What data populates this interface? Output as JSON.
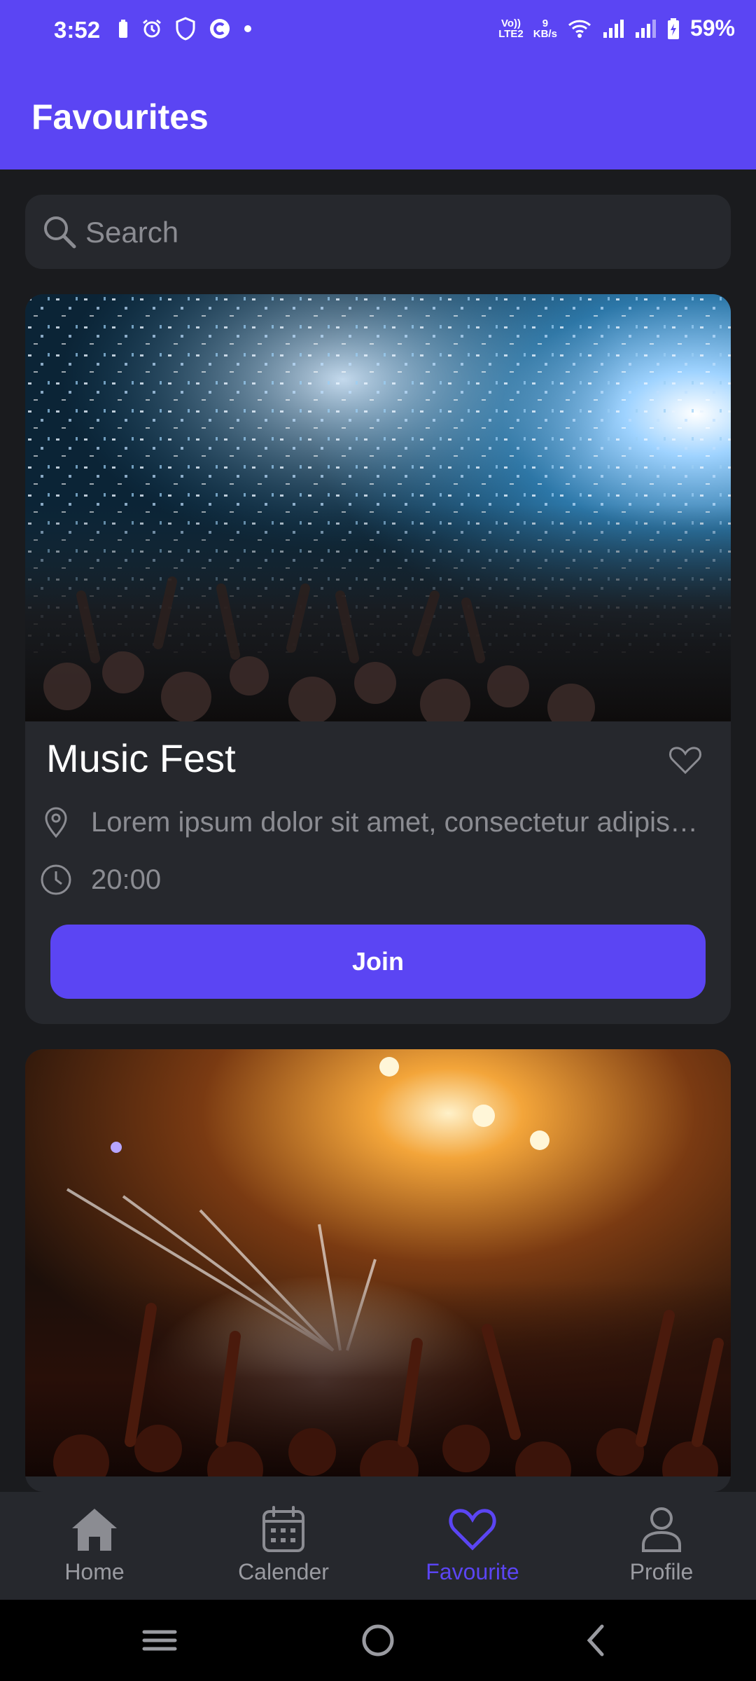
{
  "status_bar": {
    "time": "3:52",
    "net_top": "Vo))",
    "net_bottom": "LTE2",
    "speed_top": "9",
    "speed_bottom": "KB/s",
    "battery": "59%"
  },
  "app_bar": {
    "title": "Favourites"
  },
  "search": {
    "placeholder": "Search"
  },
  "events": [
    {
      "title": "Music Fest",
      "location": "Lorem ipsum dolor sit amet, consectetur adipiscing elit",
      "time": "20:00",
      "join_label": "Join",
      "favourited": false
    }
  ],
  "bottom_nav": {
    "items": [
      {
        "label": "Home",
        "icon": "home-icon"
      },
      {
        "label": "Calender",
        "icon": "calendar-icon"
      },
      {
        "label": "Favourite",
        "icon": "heart-icon",
        "active": true
      },
      {
        "label": "Profile",
        "icon": "profile-icon"
      }
    ]
  },
  "colors": {
    "accent": "#5b45f3",
    "background": "#1a1b1e",
    "card": "#26282d",
    "muted": "#8b8c92"
  }
}
